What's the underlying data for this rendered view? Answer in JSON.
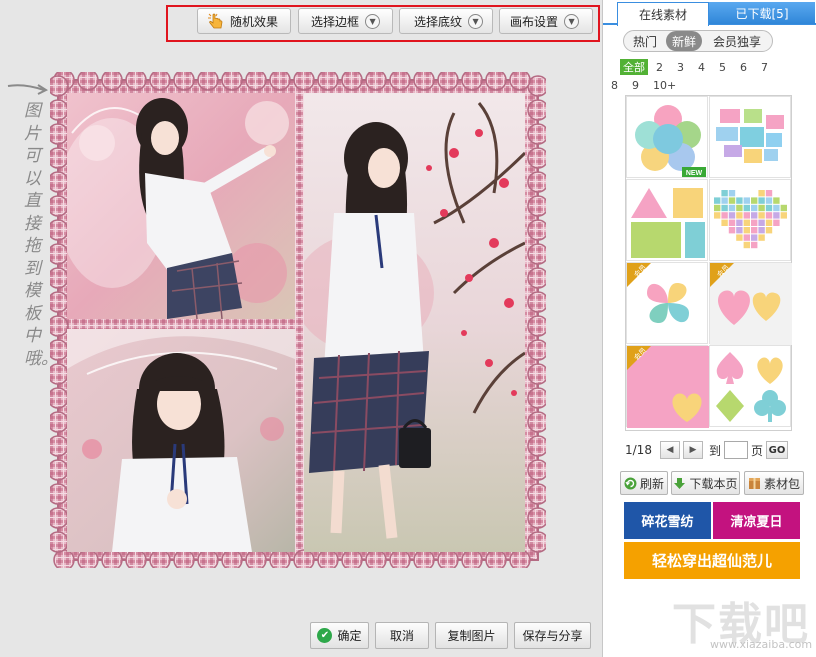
{
  "toolbar": {
    "random_label": "随机效果",
    "frame_label": "选择边框",
    "texture_label": "选择底纹",
    "canvas_label": "画布设置"
  },
  "hint": {
    "text": "图片可以直接拖到模板中哦。"
  },
  "actions": {
    "ok_label": "确定",
    "cancel_label": "取消",
    "copy_label": "复制图片",
    "save_label": "保存与分享"
  },
  "panel": {
    "tabs": [
      {
        "label": "在线素材"
      },
      {
        "label": "已下载[5]"
      }
    ],
    "filters": [
      {
        "label": "热门"
      },
      {
        "label": "新鲜"
      },
      {
        "label": "会员独享"
      }
    ],
    "counts_row1": [
      "全部",
      "2",
      "3",
      "4",
      "5",
      "6",
      "7"
    ],
    "counts_row2": [
      "8",
      "9",
      "10+"
    ],
    "templates": [
      {
        "badge": "NEW"
      },
      {
        "badge": ""
      },
      {
        "badge": ""
      },
      {
        "badge": ""
      },
      {
        "badge": "会员"
      },
      {
        "badge": "会员"
      },
      {
        "badge": "会员"
      },
      {
        "badge": ""
      }
    ],
    "pager": {
      "current": "1/18",
      "goto_prefix": "到",
      "goto_suffix": "页",
      "go_label": "GO",
      "input_value": ""
    },
    "refresh_label": "刷新",
    "download_page_label": "下载本页",
    "pack_label": "素材包",
    "promos": [
      "碎花雪纺",
      "清凉夏日",
      "轻松穿出超仙范儿"
    ]
  },
  "watermark": {
    "logo": "下载吧",
    "url": "www.xiazaiba.com"
  },
  "colors": {
    "accent": "#3a8ee0",
    "toolbar_highlight": "#e0141e",
    "border_pink": "#c98aa0",
    "promo_blue": "#1f56a8",
    "promo_magenta": "#c3127f",
    "promo_orange": "#f5a100"
  }
}
